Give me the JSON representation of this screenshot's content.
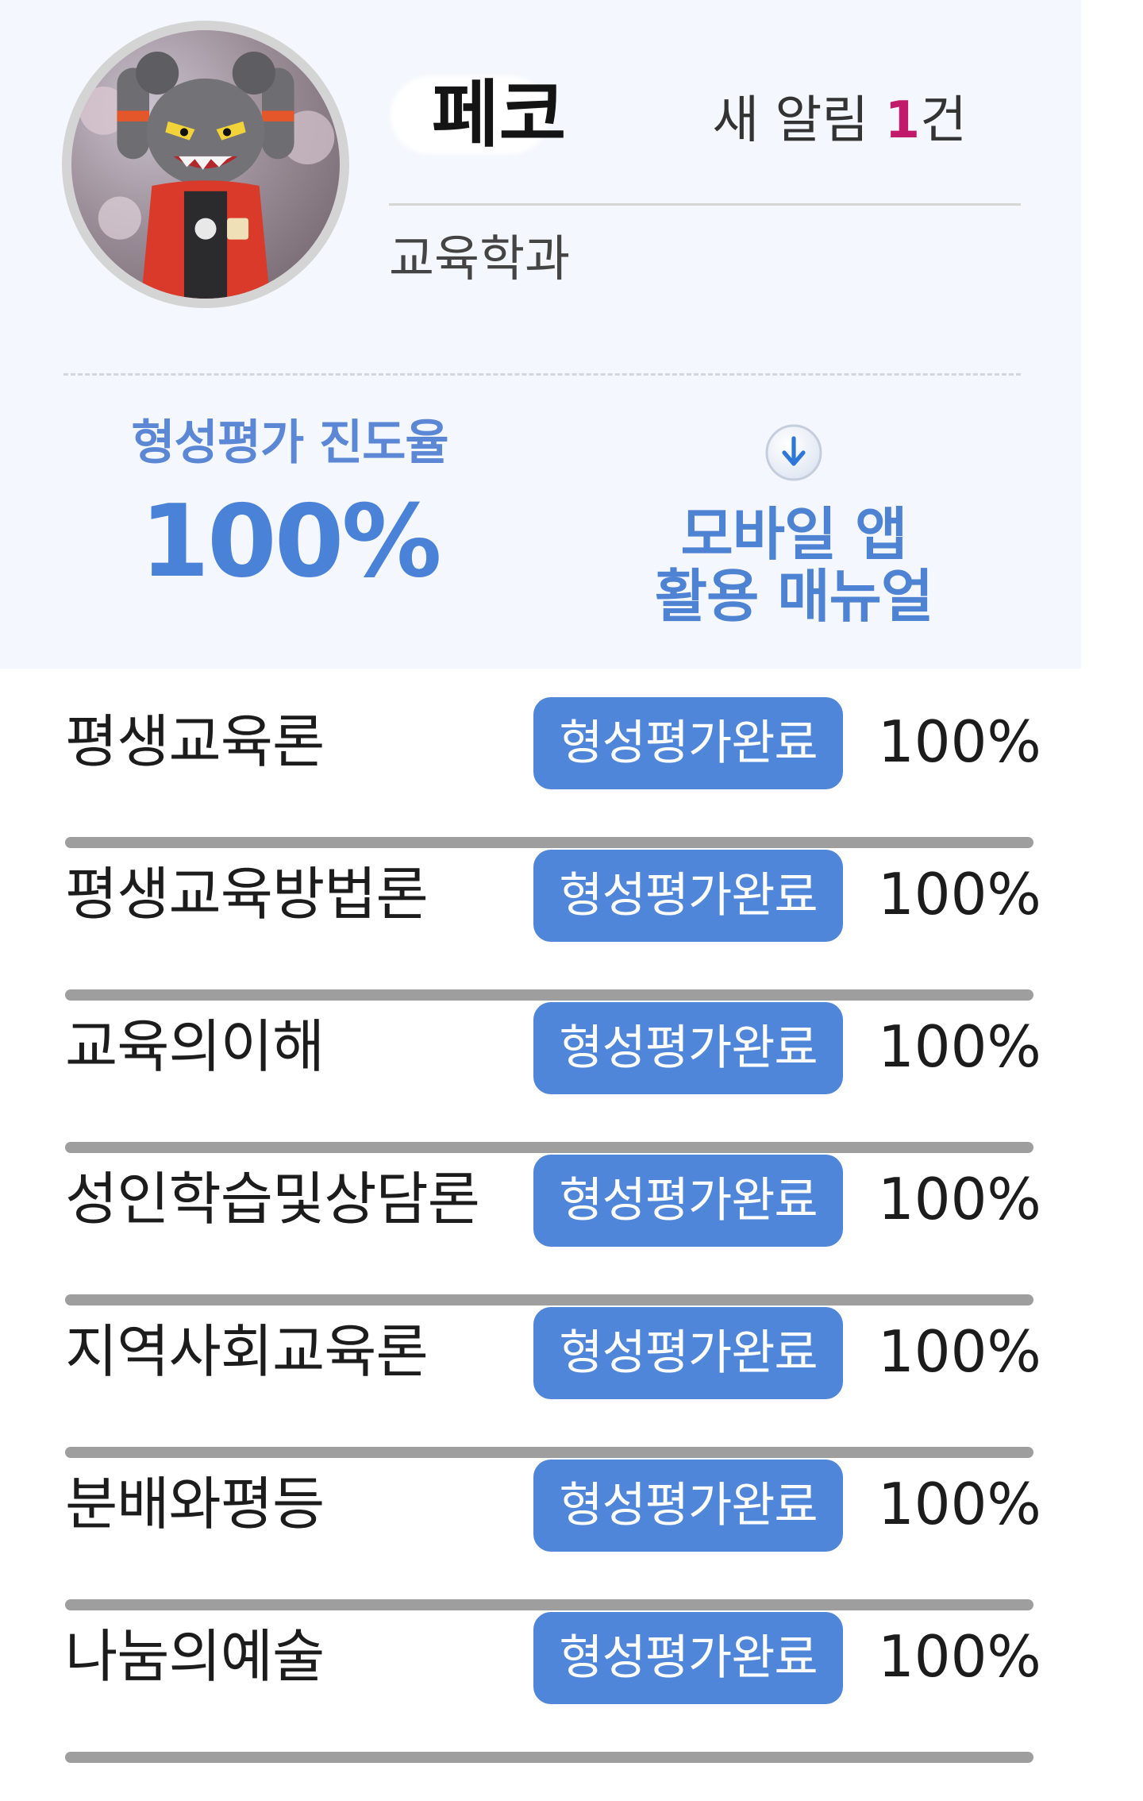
{
  "profile": {
    "nickname": "페코",
    "department": "교육학과",
    "alert": {
      "prefix": "새 알림 ",
      "count": "1",
      "suffix": "건"
    },
    "avatar_icon": "avatar-figure"
  },
  "summary": {
    "progress_label": "형성평가 진도율",
    "progress_value": "100%",
    "progress_fraction": 1.0,
    "manual_icon": "download-icon",
    "manual_line1": "모바일 앱",
    "manual_line2": "활용 매뉴얼"
  },
  "courses": [
    {
      "name": "평생교육론",
      "status": "형성평가완료",
      "percent": "100%"
    },
    {
      "name": "평생교육방법론",
      "status": "형성평가완료",
      "percent": "100%"
    },
    {
      "name": "교육의이해",
      "status": "형성평가완료",
      "percent": "100%"
    },
    {
      "name": "성인학습및상담론",
      "status": "형성평가완료",
      "percent": "100%"
    },
    {
      "name": "지역사회교육론",
      "status": "형성평가완료",
      "percent": "100%"
    },
    {
      "name": "분배와평등",
      "status": "형성평가완료",
      "percent": "100%"
    },
    {
      "name": "나눔의예술",
      "status": "형성평가완료",
      "percent": "100%"
    }
  ],
  "colors": {
    "panel_bg": "#f4f7fd",
    "accent_blue": "#4f86d9",
    "alert_count": "#c21a6a",
    "divider": "#9e9e9e"
  }
}
